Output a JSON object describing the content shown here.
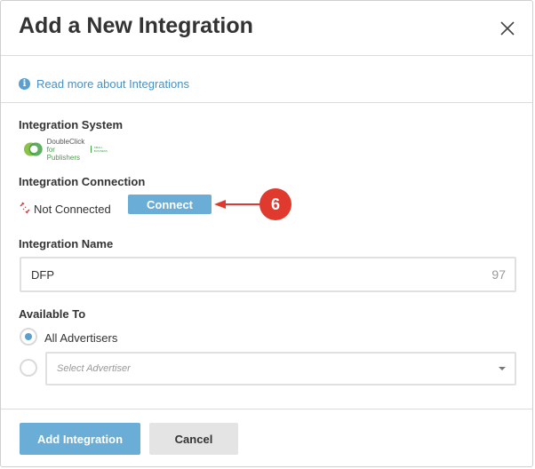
{
  "modal": {
    "title": "Add a New Integration"
  },
  "info": {
    "icon": "info-circle-icon",
    "link_text": "Read more about Integrations"
  },
  "integration_system": {
    "label": "Integration System",
    "logo_line1": "DoubleClick",
    "logo_line2": "for Publishers",
    "logo_small": "SMALL BUSINESS"
  },
  "integration_connection": {
    "label": "Integration Connection",
    "status_icon": "broken-link-icon",
    "status_text": "Not Connected",
    "connect_button": "Connect"
  },
  "annotation": {
    "step_number": "6",
    "color": "#e03a2e"
  },
  "integration_name": {
    "label": "Integration Name",
    "value": "DFP",
    "remaining_chars": "97"
  },
  "available_to": {
    "label": "Available To",
    "options": [
      {
        "label": "All Advertisers",
        "selected": true
      },
      {
        "label": "",
        "selected": false
      }
    ],
    "select_placeholder": "Select Advertiser"
  },
  "footer": {
    "primary_button": "Add Integration",
    "secondary_button": "Cancel"
  },
  "colors": {
    "accent": "#6aaed8",
    "link": "#4a90c2",
    "secondary_button_bg": "#e4e4e4"
  }
}
